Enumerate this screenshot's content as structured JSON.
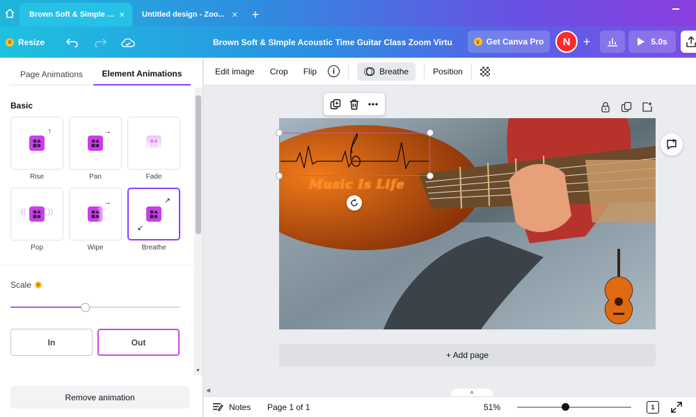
{
  "browser": {
    "tabs": [
      {
        "title": "Brown Soft & Simple A...",
        "close": "✕",
        "active": true
      },
      {
        "title": "Untitled design - Zoo...",
        "close": "✕",
        "active": false
      }
    ],
    "new_tab": "+"
  },
  "topbar": {
    "resize_label": "Resize",
    "doc_title": "Brown Soft & SImple Acoustic Time Guitar Class Zoom Virtu...",
    "pro_label": "Get Canva Pro",
    "avatar_initial": "N",
    "plus": "+",
    "play_duration": "5.0s"
  },
  "panel": {
    "tabs": [
      "Page Animations",
      "Element Animations"
    ],
    "active_tab": "Element Animations",
    "section_basic": "Basic",
    "animations": [
      {
        "label": "Rise",
        "arrow": "↑"
      },
      {
        "label": "Pan",
        "arrow": "→"
      },
      {
        "label": "Fade",
        "arrow": ""
      },
      {
        "label": "Pop",
        "arrow": ""
      },
      {
        "label": "Wipe",
        "arrow": "→"
      },
      {
        "label": "Breathe",
        "arrow": "↗↙",
        "selected": true
      }
    ],
    "scale_label": "Scale",
    "scale_value": 0.44,
    "direction": {
      "in_label": "In",
      "out_label": "Out",
      "selected": "Out"
    },
    "remove_label": "Remove animation"
  },
  "context_toolbar": {
    "edit_image": "Edit image",
    "crop": "Crop",
    "flip": "Flip",
    "info": "i",
    "animation": "Breathe",
    "position": "Position"
  },
  "canvas": {
    "overlay_text": "Music Is Life",
    "add_page": "+ Add page",
    "collapse": "˄"
  },
  "bottombar": {
    "notes": "Notes",
    "page_count": "Page 1 of 1",
    "zoom": "51%",
    "zoom_value": 0.42,
    "grid_count": "1"
  },
  "colors": {
    "accent": "#8b3dff",
    "selection": "#c54be6",
    "avatar": "#ff2a2a",
    "text_orange": "#ff8a1c"
  }
}
